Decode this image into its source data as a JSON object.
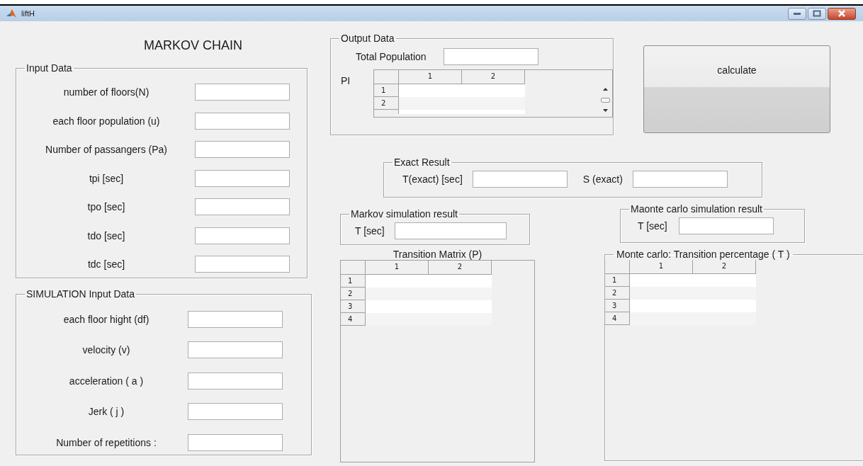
{
  "window": {
    "title": "liftH"
  },
  "heading": "MARKOV CHAIN",
  "input_data": {
    "title": "Input Data",
    "fields": [
      {
        "label": "number of floors(N)"
      },
      {
        "label": "each floor population (u)"
      },
      {
        "label": "Number of passangers (Pa)"
      },
      {
        "label": "tpi [sec]"
      },
      {
        "label": "tpo [sec]"
      },
      {
        "label": "tdo [sec]"
      },
      {
        "label": "tdc [sec]"
      }
    ]
  },
  "simulation_input": {
    "title": "SIMULATION Input Data",
    "fields": [
      {
        "label": "each floor hight (df)"
      },
      {
        "label": "velocity (v)"
      },
      {
        "label": "acceleration ( a )"
      },
      {
        "label": "Jerk ( j )"
      },
      {
        "label": "Number of repetitions :"
      }
    ]
  },
  "output_data": {
    "title": "Output Data",
    "total_population": {
      "label": "Total Population"
    },
    "pi_table": {
      "label": "PI",
      "columns": [
        "1",
        "2"
      ],
      "rows": [
        "1",
        "2"
      ]
    }
  },
  "calculate_button": {
    "label": "calculate"
  },
  "exact_result": {
    "title": "Exact Result",
    "fields": [
      {
        "label": "T(exact) [sec]"
      },
      {
        "label": "S (exact)"
      }
    ]
  },
  "markov_result": {
    "title": "Markov simulation result",
    "field": {
      "label": "T [sec]"
    }
  },
  "monte_carlo_result": {
    "title": "Maonte carlo simulation result",
    "field": {
      "label": "T [sec]"
    }
  },
  "transition_matrix": {
    "title": "Transition Matrix (P)",
    "columns": [
      "1",
      "2"
    ],
    "rows": [
      "1",
      "2",
      "3",
      "4"
    ]
  },
  "transition_percentage": {
    "title": "Monte carlo: Transition percentage ( T )",
    "columns": [
      "1",
      "2"
    ],
    "rows": [
      "1",
      "2",
      "3",
      "4"
    ]
  }
}
